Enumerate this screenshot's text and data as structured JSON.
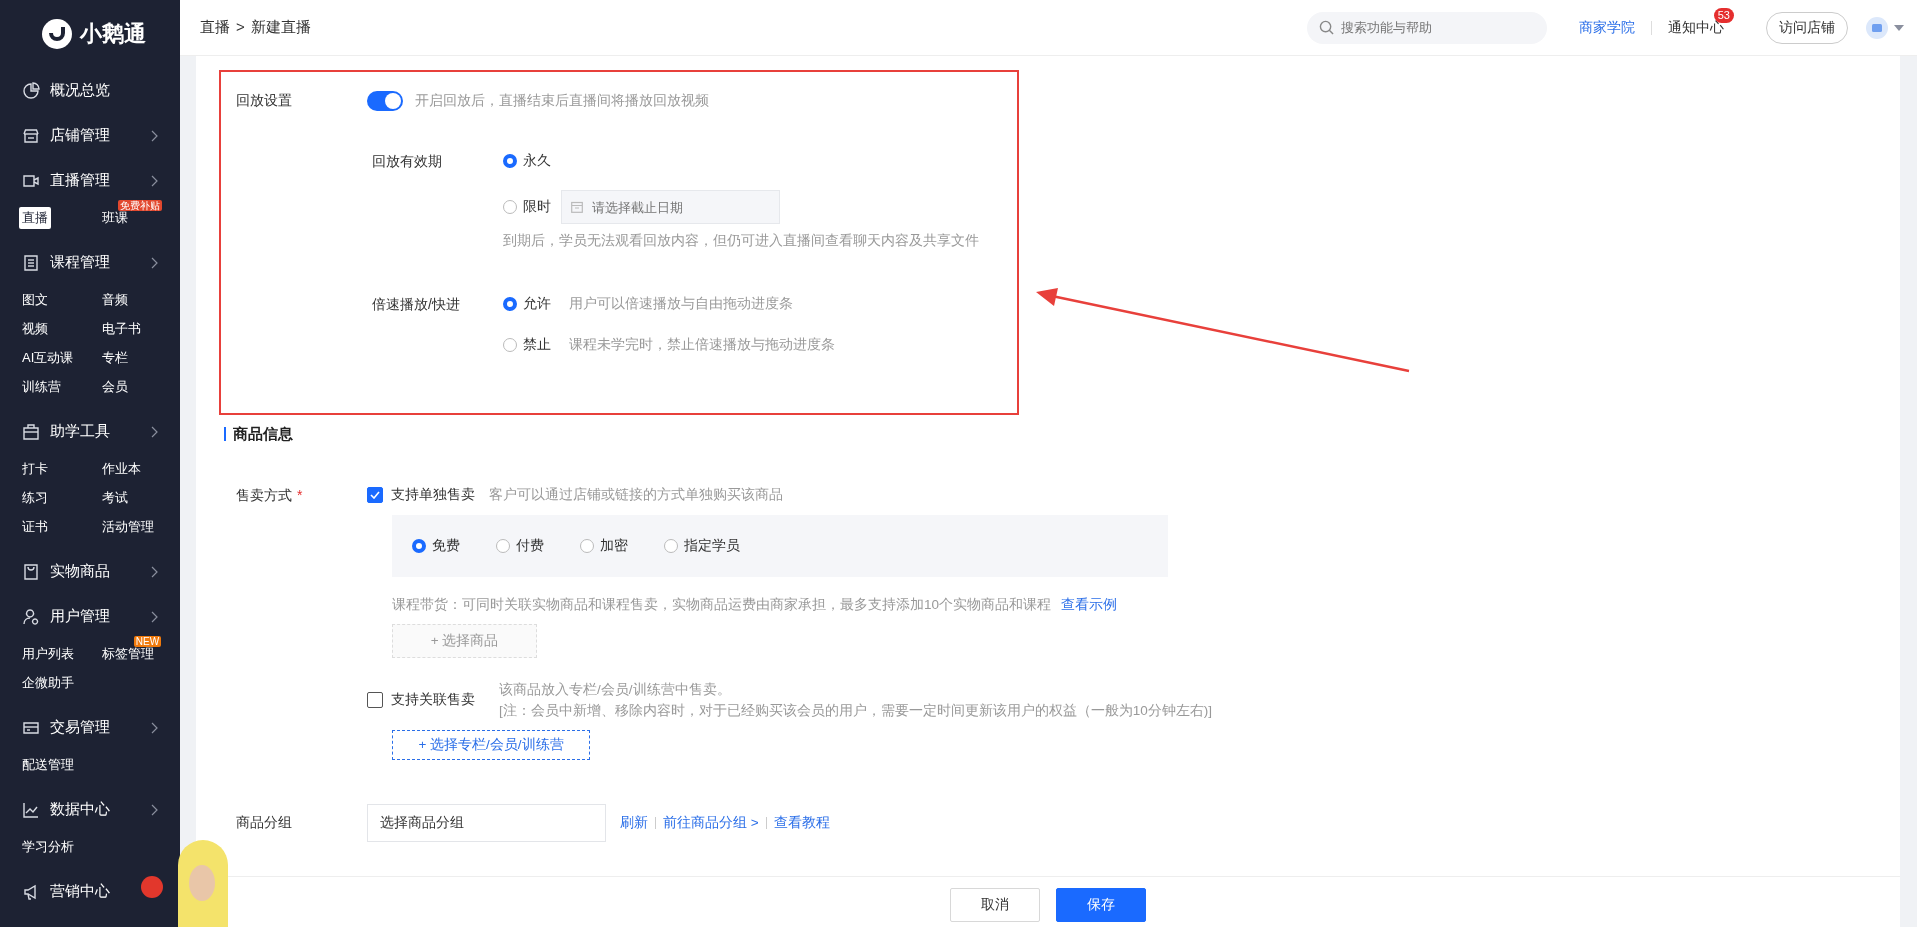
{
  "logo": {
    "text": "小鹅通"
  },
  "sidebar": {
    "groups": [
      {
        "label": "概况总览",
        "expandable": false
      },
      {
        "label": "店铺管理",
        "expandable": true
      },
      {
        "label": "直播管理",
        "expandable": true,
        "items": [
          {
            "label": "直播",
            "selected": true
          },
          {
            "label": "班课",
            "selected": false,
            "badge": {
              "text": "免费补贴",
              "color": "#e2482e"
            }
          }
        ]
      },
      {
        "label": "课程管理",
        "expandable": true,
        "items": [
          {
            "label": "图文",
            "selected": false
          },
          {
            "label": "音频",
            "selected": false
          },
          {
            "label": "视频",
            "selected": false
          },
          {
            "label": "电子书",
            "selected": false
          },
          {
            "label": "AI互动课",
            "selected": false
          },
          {
            "label": "专栏",
            "selected": false
          },
          {
            "label": "训练营",
            "selected": false
          },
          {
            "label": "会员",
            "selected": false
          }
        ]
      },
      {
        "label": "助学工具",
        "expandable": true,
        "items": [
          {
            "label": "打卡",
            "selected": false
          },
          {
            "label": "作业本",
            "selected": false
          },
          {
            "label": "练习",
            "selected": false
          },
          {
            "label": "考试",
            "selected": false
          },
          {
            "label": "证书",
            "selected": false
          },
          {
            "label": "活动管理",
            "selected": false
          }
        ]
      },
      {
        "label": "实物商品",
        "expandable": true
      },
      {
        "label": "用户管理",
        "expandable": true,
        "items": [
          {
            "label": "用户列表",
            "selected": false
          },
          {
            "label": "标签管理",
            "selected": false,
            "badge": {
              "text": "NEW",
              "color": "#f07a0c"
            }
          },
          {
            "label": "企微助手",
            "selected": false
          }
        ]
      },
      {
        "label": "交易管理",
        "expandable": true,
        "items": [
          {
            "label": "配送管理",
            "selected": false
          }
        ]
      },
      {
        "label": "数据中心",
        "expandable": true,
        "items": [
          {
            "label": "学习分析",
            "selected": false
          }
        ]
      },
      {
        "label": "营销中心"
      }
    ]
  },
  "topbar": {
    "breadcrumb": [
      "直播",
      "新建直播"
    ],
    "separator": ">",
    "search": {
      "placeholder": "搜索功能与帮助"
    },
    "academy_link": "商家学院",
    "notifications": {
      "label": "通知中心",
      "badge": "53"
    },
    "visit_button": "访问店铺"
  },
  "playback": {
    "label": "回放设置",
    "on": true,
    "hint": "开启回放后，直播结束后直播间将播放回放视频",
    "validity": {
      "label": "回放有效期",
      "options": [
        {
          "label": "永久",
          "selected": true
        },
        {
          "label": "限时",
          "selected": false,
          "kind": "date",
          "placeholder": "请选择截止日期"
        }
      ],
      "hint": "到期后，学员无法观看回放内容，但仍可进入直播间查看聊天内容及共享文件"
    },
    "speed": {
      "label": "倍速播放/快进",
      "options": [
        {
          "label": "允许",
          "selected": true,
          "description": "用户可以倍速播放与自由拖动进度条"
        },
        {
          "label": "禁止",
          "selected": false,
          "description": "课程未学完时，禁止倍速播放与拖动进度条"
        }
      ]
    }
  },
  "goods": {
    "title": "商品信息",
    "sale_mode": {
      "label": "售卖方式",
      "required": true,
      "required_mark": "*",
      "standalone": {
        "label": "支持单独售卖",
        "checked": true,
        "hint": "客户可以通过店铺或链接的方式单独购买该商品"
      },
      "price_options": [
        {
          "label": "免费",
          "selected": true
        },
        {
          "label": "付费",
          "selected": false
        },
        {
          "label": "加密",
          "selected": false
        },
        {
          "label": "指定学员",
          "selected": false
        }
      ],
      "bundle_hint": "课程带货：可同时关联实物商品和课程售卖，实物商品运费由商家承担，最多支持添加10个实物商品和课程",
      "bundle_link": "查看示例",
      "select_goods_button": {
        "label": "+ 选择商品",
        "disabled": true
      },
      "related": {
        "label": "支持关联售卖",
        "checked": false,
        "notes": [
          "该商品放入专栏/会员/训练营中售卖。",
          "[注：会员中新增、移除内容时，对于已经购买该会员的用户，需要一定时间更新该用户的权益（一般为10分钟左右)]"
        ],
        "button": "+ 选择专栏/会员/训练营"
      }
    },
    "group": {
      "label": "商品分组",
      "value": "选择商品分组",
      "links": [
        "刷新",
        "前往商品分组 >",
        "查看教程"
      ]
    }
  },
  "footer": {
    "buttons": [
      {
        "label": "取消",
        "kind": "default"
      },
      {
        "label": "保存",
        "kind": "primary"
      }
    ]
  }
}
